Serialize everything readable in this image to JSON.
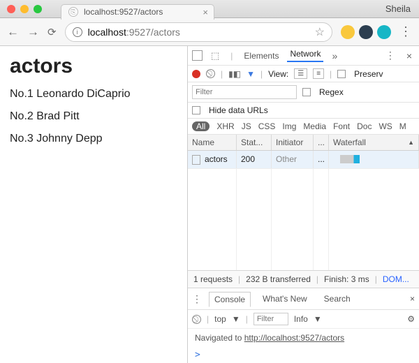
{
  "window": {
    "tab_title": "localhost:9527/actors",
    "user": "Sheila"
  },
  "toolbar": {
    "address_host": "localhost",
    "address_port_path": ":9527/actors"
  },
  "page": {
    "heading": "actors",
    "items": [
      "No.1 Leonardo DiCaprio",
      "No.2 Brad Pitt",
      "No.3 Johnny Depp"
    ]
  },
  "devtools": {
    "panels": {
      "elements": "Elements",
      "network": "Network",
      "more": "»"
    },
    "network_toolbar": {
      "view_label": "View:",
      "preserve_label": "Preserv",
      "filter_placeholder": "Filter",
      "regex_label": "Regex",
      "hide_data_urls_label": "Hide data URLs"
    },
    "filter_pills": [
      "All",
      "XHR",
      "JS",
      "CSS",
      "Img",
      "Media",
      "Font",
      "Doc",
      "WS",
      "M"
    ],
    "table": {
      "headers": {
        "name": "Name",
        "status": "Stat...",
        "initiator": "Initiator",
        "dots": "...",
        "waterfall": "Waterfall"
      },
      "rows": [
        {
          "name": "actors",
          "status": "200",
          "initiator": "Other",
          "dots": "..."
        }
      ]
    },
    "status": {
      "requests": "1 requests",
      "transferred": "232 B transferred",
      "finish": "Finish: 3 ms",
      "dom": "DOM..."
    },
    "drawer": {
      "tabs": {
        "console": "Console",
        "whatsnew": "What's New",
        "search": "Search"
      },
      "context": "top",
      "filter_placeholder": "Filter",
      "level": "Info",
      "message_prefix": "Navigated to ",
      "message_url": "http://localhost:9527/actors",
      "prompt": ">"
    }
  }
}
